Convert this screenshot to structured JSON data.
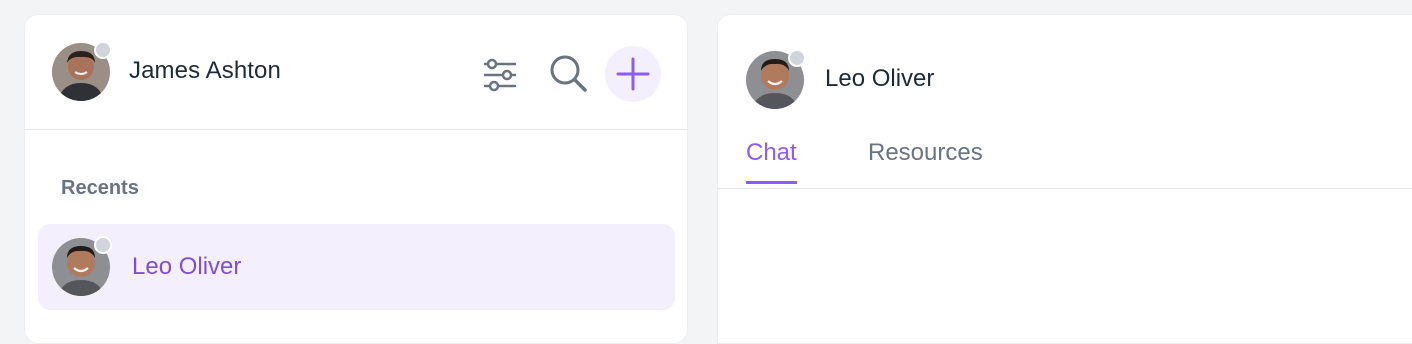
{
  "user": {
    "name": "James Ashton",
    "status": "offline",
    "avatar_icon": "user-avatar"
  },
  "toolbar": {
    "filter_icon": "sliders-icon",
    "search_icon": "search-icon",
    "add_icon": "plus-icon"
  },
  "sidebar": {
    "section_title": "Recents",
    "conversations": [
      {
        "name": "Leo Oliver",
        "status": "offline",
        "selected": true
      }
    ]
  },
  "chat": {
    "contact_name": "Leo Oliver",
    "contact_status": "offline",
    "tabs": [
      {
        "label": "Chat",
        "active": true
      },
      {
        "label": "Resources",
        "active": false
      }
    ]
  },
  "colors": {
    "accent": "#8b5cf6",
    "accent_text": "#7e4fd6",
    "selected_bg": "#f3effc",
    "status_offline": "#d1d5db",
    "background": "#f3f4f6"
  }
}
